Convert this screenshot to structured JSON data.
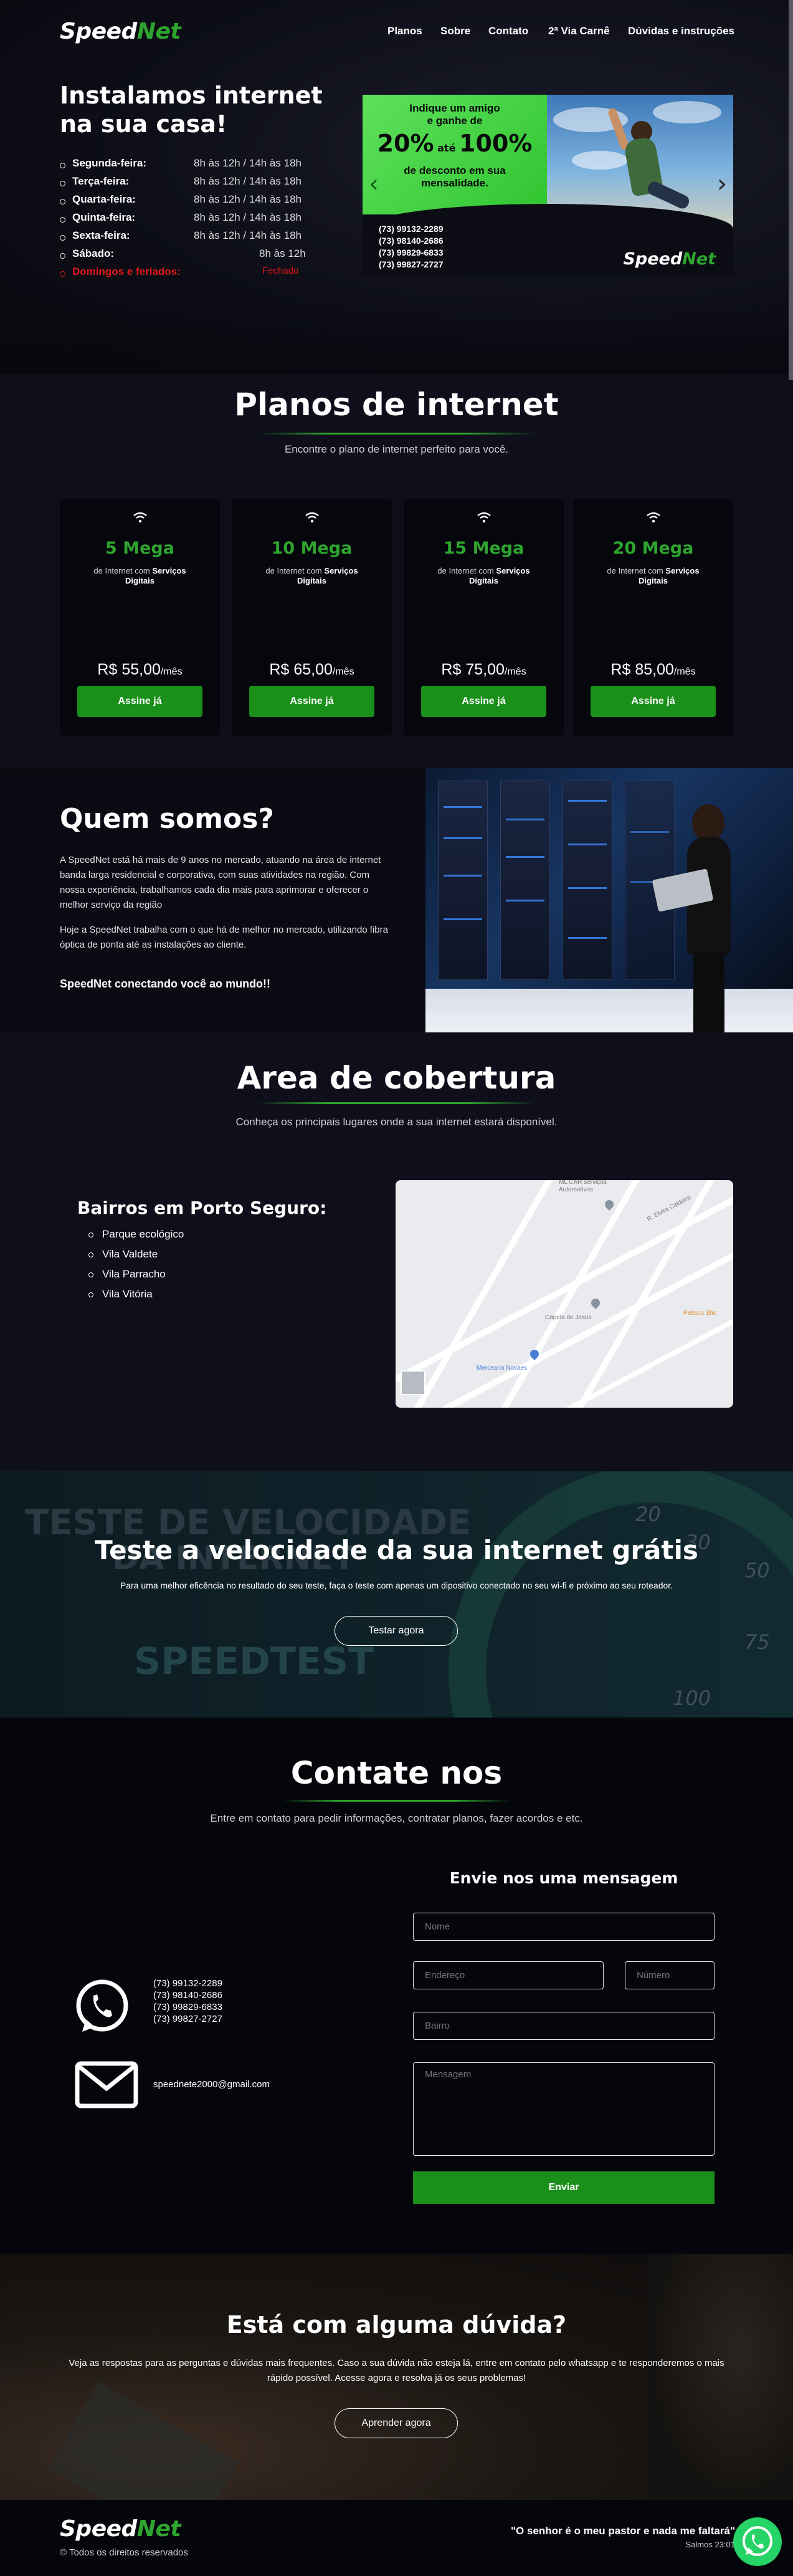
{
  "brand": {
    "logo_part1": "Speed",
    "logo_part2": "Net",
    "accent": "#2ea52e"
  },
  "nav": {
    "items": [
      "Planos",
      "Sobre",
      "Contato",
      "2ª Via Carnê",
      "Dúvidas e instruções"
    ]
  },
  "hero": {
    "title": "Instalamos internet na sua casa!",
    "hours": [
      {
        "day": "Segunda-feira:",
        "time": "8h às 12h / 14h às 18h"
      },
      {
        "day": "Terça-feira:",
        "time": "8h às 12h / 14h às 18h"
      },
      {
        "day": "Quarta-feira:",
        "time": "8h às 12h / 14h às 18h"
      },
      {
        "day": "Quinta-feira:",
        "time": "8h às 12h / 14h às 18h"
      },
      {
        "day": "Sexta-feira:",
        "time": "8h às 12h / 14h às 18h"
      },
      {
        "day": "Sábado:",
        "time": "8h às 12h"
      },
      {
        "day": "Domingos e feriados:",
        "time": "Fechado"
      }
    ]
  },
  "banner": {
    "line1": "Indique um amigo",
    "line2": "e ganhe de",
    "pct1": "20%",
    "ate": "até",
    "pct2": "100%",
    "line3": "de desconto em sua",
    "line4": "mensalidade.",
    "phones": [
      "(73) 99132-2289",
      "(73) 98140-2686",
      "(73) 99829-6833",
      "(73) 99827-2727"
    ],
    "logo_part1": "Speed",
    "logo_part2": "Net",
    "prev": "‹",
    "next": "›"
  },
  "planos": {
    "title": "Planos de internet",
    "subtitle": "Encontre o plano de internet perfeito para você.",
    "items": [
      {
        "name": "5 Mega",
        "desc": "de Internet com ",
        "desc_bold": "Serviços Digitais",
        "price": "R$ 55,00",
        "unit": "/mês",
        "cta": "Assine já"
      },
      {
        "name": "10 Mega",
        "desc": "de Internet com ",
        "desc_bold": "Serviços Digitais",
        "price": "R$ 65,00",
        "unit": "/mês",
        "cta": "Assine já"
      },
      {
        "name": "15 Mega",
        "desc": "de Internet com ",
        "desc_bold": "Serviços Digitais",
        "price": "R$ 75,00",
        "unit": "/mês",
        "cta": "Assine já"
      },
      {
        "name": "20 Mega",
        "desc": "de Internet com ",
        "desc_bold": "Serviços Digitais",
        "price": "R$ 85,00",
        "unit": "/mês",
        "cta": "Assine já"
      }
    ]
  },
  "quem": {
    "title": "Quem somos?",
    "p1": "A SpeedNet está há mais de 9 anos no mercado, atuando na área de internet banda larga residencial e corporativa, com suas atividades na região. Com nossa experiência, trabalhamos cada dia mais para aprimorar e oferecer o melhor serviço da região",
    "p2": "Hoje a SpeedNet trabalha com o que há de melhor no mercado, utilizando fibra óptica de ponta até as instalações ao cliente.",
    "tagline": "SpeedNet conectando você ao mundo!!"
  },
  "cobertura": {
    "title": "Area de cobertura",
    "subtitle": "Conheça os principais lugares onde a sua internet estará disponível.",
    "bairros_title": "Bairros em Porto Seguro:",
    "bairros": [
      "Parque ecológico",
      "Vila Valdete",
      "Vila Parracho",
      "Vila Vitória"
    ],
    "map_labels": [
      "ML CAR serviços",
      "Automotivos",
      "Capela de Jesus",
      "Mercearia Novaes",
      "Petisco Sho",
      "R. Elvira Caldeira"
    ]
  },
  "speedtest": {
    "ghost1": "TESTE DE VELOCIDADE",
    "ghost2": "DA INTERNET",
    "ghost3": "SPEEDTEST",
    "gauge_numbers": [
      "20",
      "30",
      "50",
      "75",
      "100"
    ],
    "title": "Teste a velocidade da sua internet grátis",
    "text": "Para uma melhor eficência no resultado do seu teste, faça o teste com apenas um dipositivo conectado no seu wi-fi e próximo ao seu roteador.",
    "cta": "Testar agora"
  },
  "contato": {
    "title": "Contate nos",
    "subtitle": "Entre em contato para pedir informações, contratar planos, fazer acordos e etc.",
    "phones": [
      "(73) 99132-2289",
      "(73) 98140-2686",
      "(73) 99829-6833",
      "(73) 99827-2727"
    ],
    "email": "speednete2000@gmail.com",
    "form_title": "Envie nos uma mensagem",
    "ph_nome": "Nome",
    "ph_endereco": "Endereço",
    "ph_numero": "Número",
    "ph_bairro": "Bairro",
    "ph_mensagem": "Mensagem",
    "send": "Enviar"
  },
  "duvida": {
    "title": "Está com alguma dúvida?",
    "text": "Veja as respostas para as perguntas e dúvidas mais frequentes. Caso a sua dúvida não esteja lá, entre em contato pelo whatsapp e te responderemos o mais rápido possível. Acesse agora e resolva já os seus problemas!",
    "cta": "Aprender agora"
  },
  "footer": {
    "logo_part1": "Speed",
    "logo_part2": "Net",
    "rights": "© Todos os direitos reservados",
    "quote": "\"O senhor é o meu pastor e nada me faltará\"",
    "ref": "Salmos 23:01"
  }
}
